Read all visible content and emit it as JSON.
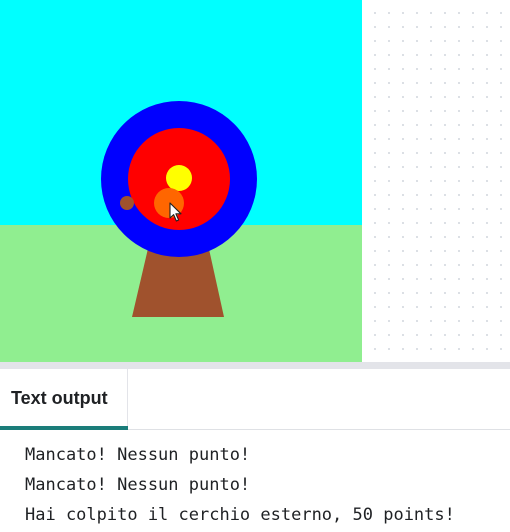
{
  "stage": {
    "sky_color": "#00ffff",
    "grass_color": "#90ee90",
    "stand_color": "#a0522d",
    "target_rings": [
      "#0000ff",
      "#ff0000",
      "#ffff00"
    ],
    "arrow_hit_colors": [
      "#ff6600",
      "#a0522d"
    ],
    "cursor": "arrow-pointer"
  },
  "tabs": [
    {
      "label": "Text output",
      "active": true
    }
  ],
  "output": {
    "lines": [
      "Mancato! Nessun punto!",
      "Mancato! Nessun punto!",
      "Hai colpito il cerchio esterno, 50 points!"
    ]
  }
}
